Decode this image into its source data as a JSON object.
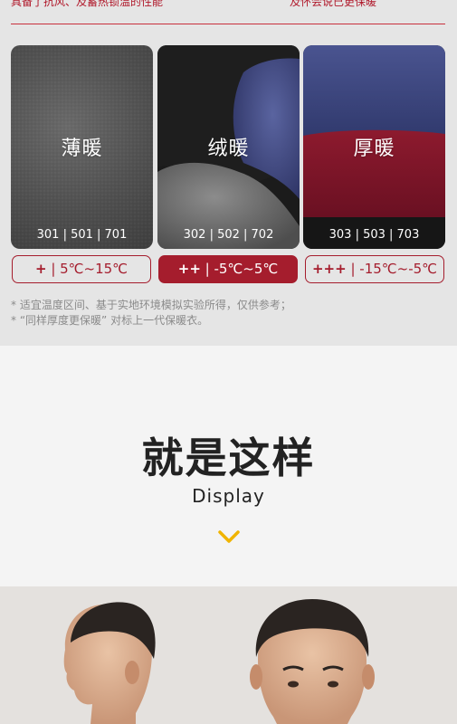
{
  "top_partial": {
    "left_text": "具备了抗风、及蓄热锁温的性能",
    "right_text": "及怀会说已更保暖"
  },
  "products": [
    {
      "title": "薄暖",
      "codes": "301 | 501 | 701",
      "badge_plus": "+",
      "badge_range": " | 5℃~15℃",
      "active": false
    },
    {
      "title": "绒暖",
      "codes": "302 | 502 | 702",
      "badge_plus": "++",
      "badge_range": " | -5℃~5℃",
      "active": true
    },
    {
      "title": "厚暖",
      "codes": "303 | 503 | 703",
      "badge_plus": "+++",
      "badge_range": " | -15℃~-5℃",
      "active": false
    }
  ],
  "notes": [
    "* 适宜温度区间、基于实地环境模拟实验所得，仅供参考；",
    "* “同样厚度更保暖” 对标上一代保暖衣。"
  ],
  "display_section": {
    "heading": "就是这样",
    "subheading": "Display",
    "chevron_icon": "chevron-down-icon"
  },
  "colors": {
    "brand_red": "#a51d2d",
    "chevron": "#f0b400",
    "top_background": "#e5e5e5",
    "section_background": "#f4f4f4"
  }
}
